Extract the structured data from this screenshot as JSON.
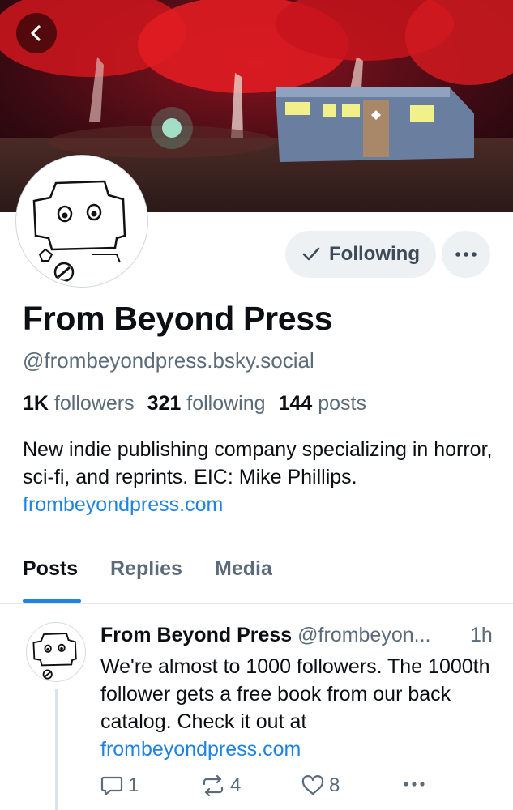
{
  "header": {
    "back_icon": "chevron-left-icon"
  },
  "profile": {
    "display_name": "From Beyond Press",
    "handle": "@frombeyondpress.bsky.social",
    "followers_count": "1K",
    "followers_label": "followers",
    "following_count": "321",
    "following_label": "following",
    "posts_count": "144",
    "posts_label": "posts",
    "bio_text": "New indie publishing company specializing in horror, sci-fi, and reprints. EIC: Mike Phillips. ",
    "bio_link": "frombeyondpress.com",
    "follow_button_label": "Following",
    "follow_icon": "checkmark-icon",
    "more_icon": "ellipsis-icon"
  },
  "tabs": [
    {
      "label": "Posts",
      "active": true
    },
    {
      "label": "Replies",
      "active": false
    },
    {
      "label": "Media",
      "active": false
    }
  ],
  "post": {
    "author": "From Beyond Press",
    "handle": "@frombeyon...",
    "time": "1h",
    "text": "We're almost to 1000 followers. The 1000th follower gets a free book from our back catalog. Check it out at ",
    "link": "frombeyondpress.com",
    "reply_count": "1",
    "repost_count": "4",
    "like_count": "8"
  },
  "colors": {
    "accent": "#1f83e0",
    "muted_text": "#5c6b7a",
    "button_bg": "#eef1f4"
  }
}
